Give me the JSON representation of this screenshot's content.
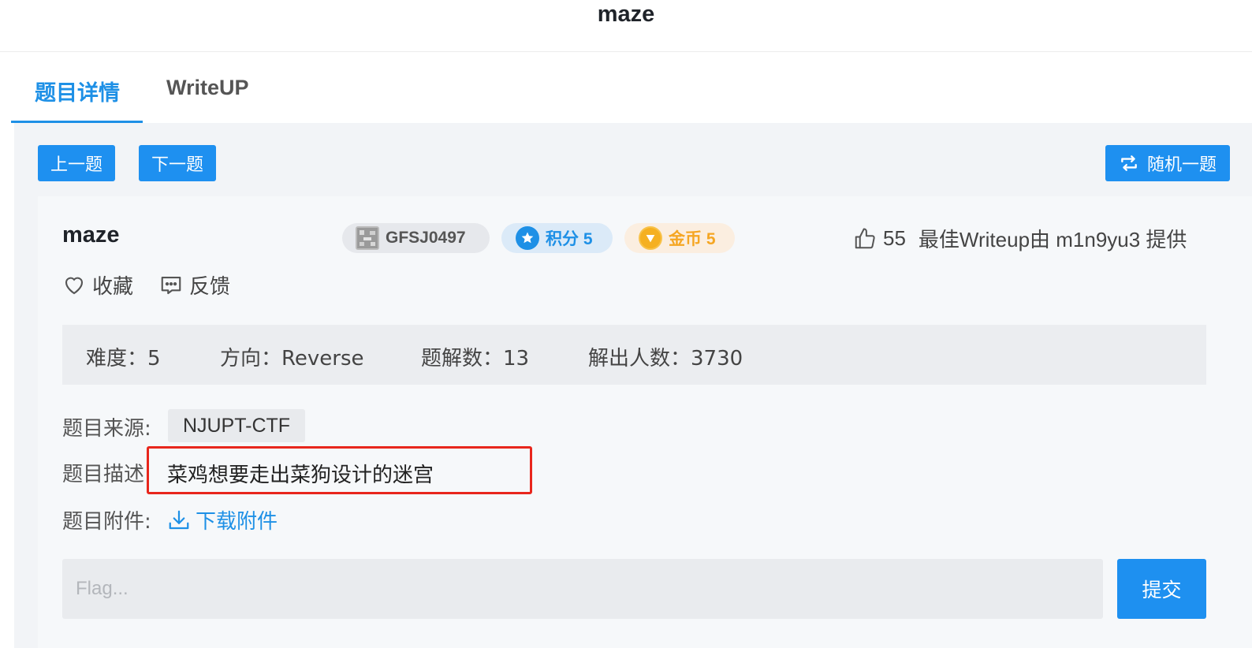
{
  "header": {
    "title": "maze"
  },
  "tabs": [
    {
      "label": "题目详情",
      "active": true
    },
    {
      "label": "WriteUP",
      "active": false
    }
  ],
  "nav": {
    "prev_label": "上一题",
    "next_label": "下一题",
    "random_label": "随机一题"
  },
  "problem": {
    "title": "maze",
    "id_badge": "GFSJ0497",
    "points_badge": "积分 5",
    "coins_badge": "金币 5",
    "likes": "55",
    "best_writeup": "最佳Writeup由 m1n9yu3 提供",
    "favorite_label": "收藏",
    "feedback_label": "反馈"
  },
  "info": {
    "difficulty": "难度：5",
    "direction": "方向：Reverse",
    "writeups": "题解数：13",
    "solvers": "解出人数：3730"
  },
  "details": {
    "source_label": "题目来源:",
    "source_value": "NJUPT-CTF",
    "desc_label": "题目描述:",
    "desc_value": "菜鸡想要走出菜狗设计的迷宫",
    "attach_label": "题目附件:",
    "download_label": "下载附件"
  },
  "flag": {
    "placeholder": "Flag...",
    "submit_label": "提交"
  },
  "colors": {
    "accent": "#1e90f0",
    "highlight_box": "#e8261c",
    "points": "#1e90e6",
    "coins": "#f5a623"
  }
}
